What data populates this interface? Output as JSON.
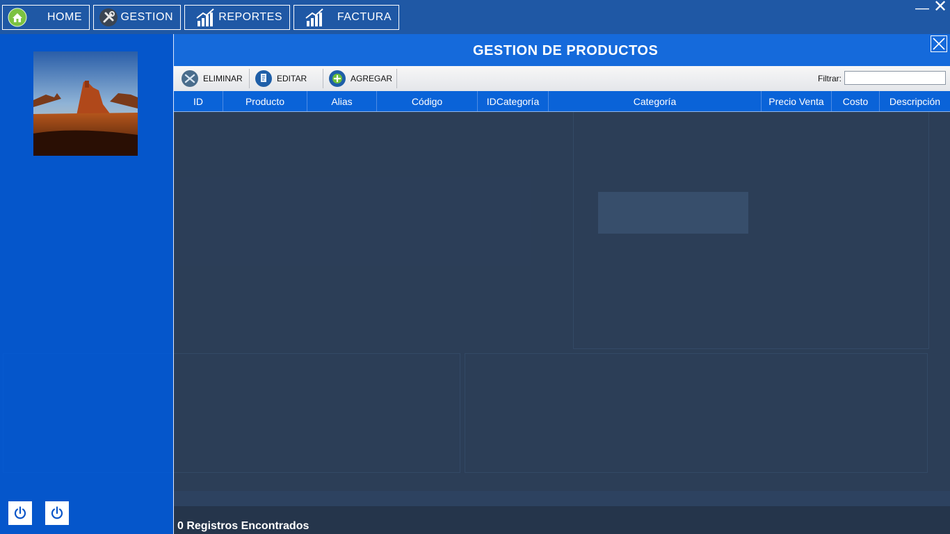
{
  "nav": {
    "home_label": "HOME",
    "gestion_label": "GESTION",
    "reportes_label": "REPORTES",
    "factura_label": "FACTURA",
    "minimize_icon": "minimize-icon",
    "close_icon": "close-icon"
  },
  "main": {
    "title": "GESTION DE PRODUCTOS",
    "close_icon": "close-box-icon"
  },
  "toolbar": {
    "eliminar_label": "ELIMINAR",
    "editar_label": "EDITAR",
    "agregar_label": "AGREGAR",
    "filter_label": "Filtrar:",
    "filter_value": ""
  },
  "grid": {
    "columns": [
      "ID",
      "Producto",
      "Alias",
      "Código",
      "IDCategoría",
      "Categoría",
      "Precio Venta",
      "Costo",
      "Descripción"
    ],
    "rows": []
  },
  "status": {
    "records_text": "0 Registros Encontrados"
  },
  "colors": {
    "accent": "#0a63d8",
    "sidebar": "#005adc"
  }
}
